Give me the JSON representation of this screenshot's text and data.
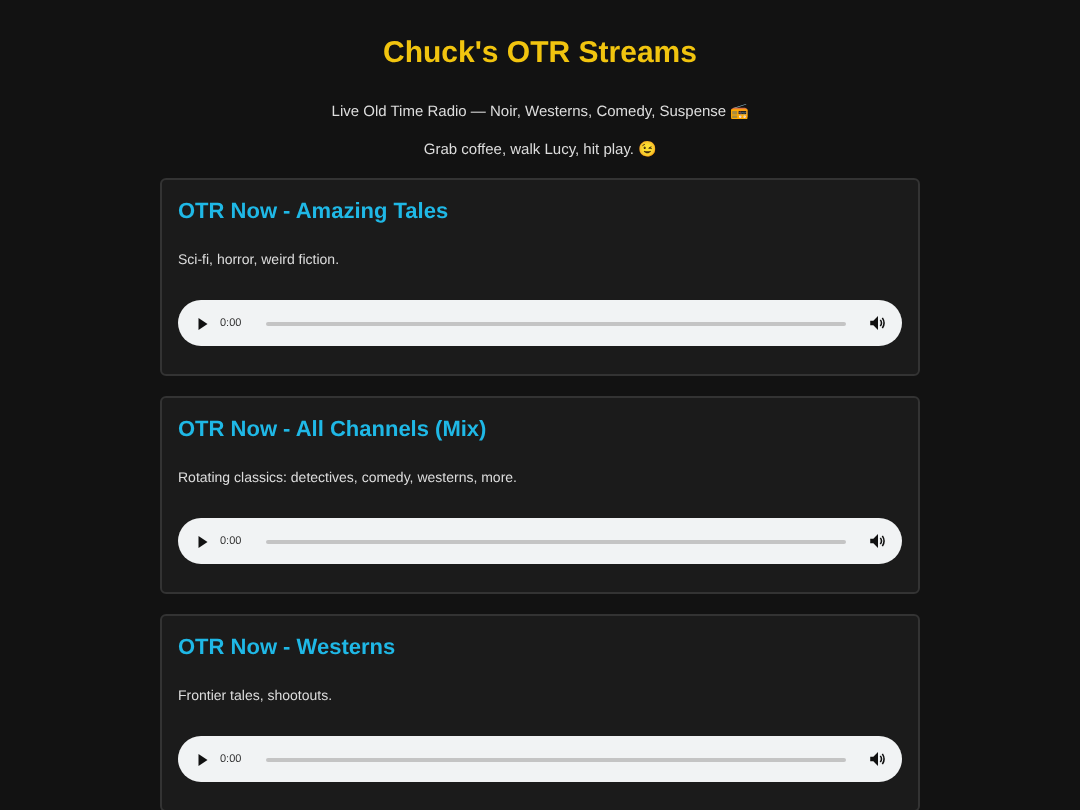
{
  "header": {
    "title": "Chuck's OTR Streams",
    "tagline": "Live Old Time Radio — Noir, Westerns, Comedy, Suspense 📻",
    "note": "Grab coffee, walk Lucy, hit play. 😉"
  },
  "streams": [
    {
      "title": "OTR Now - Amazing Tales",
      "description": "Sci-fi, horror, weird fiction.",
      "player": {
        "time": "0:00"
      }
    },
    {
      "title": "OTR Now - All Channels (Mix)",
      "description": "Rotating classics: detectives, comedy, westerns, more.",
      "player": {
        "time": "0:00"
      }
    },
    {
      "title": "OTR Now - Westerns",
      "description": "Frontier tales, shootouts.",
      "player": {
        "time": "0:00"
      }
    }
  ]
}
